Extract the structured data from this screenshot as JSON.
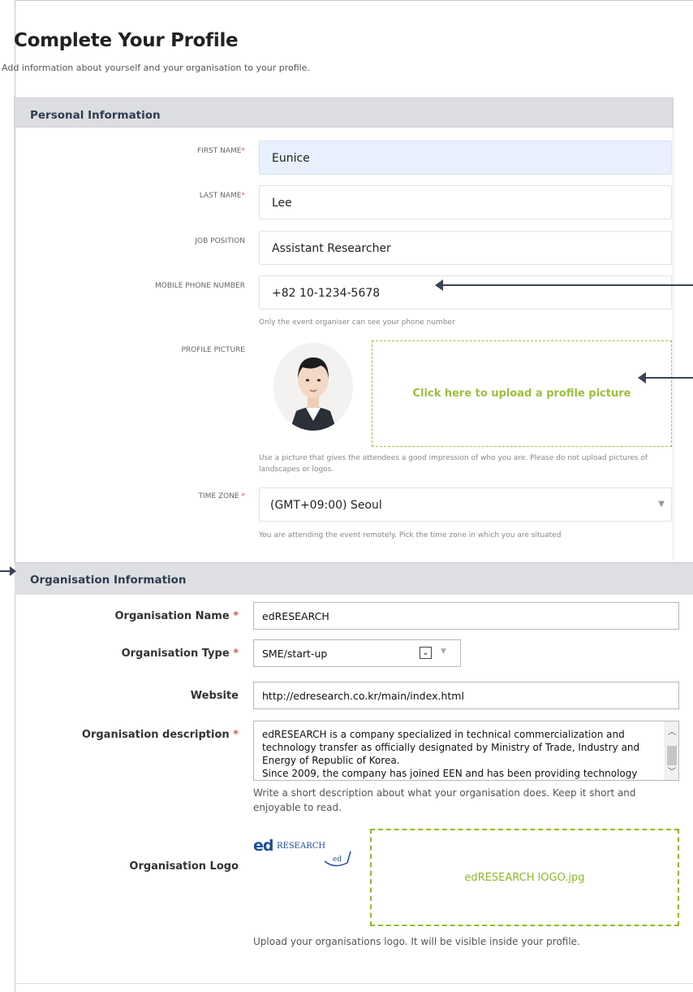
{
  "header": {
    "title": "Complete Your Profile",
    "subtitle": "Add information about yourself and your organisation to your profile."
  },
  "personal": {
    "section_title": "Personal Information",
    "first_name": {
      "label": "FIRST NAME",
      "required_mark": "*",
      "value": "Eunice"
    },
    "last_name": {
      "label": "LAST NAME",
      "required_mark": "*",
      "value": "Lee"
    },
    "job_position": {
      "label": "JOB POSITION",
      "value": "Assistant Researcher"
    },
    "mobile": {
      "label": "MOBILE PHONE NUMBER",
      "value": "+82 10-1234-5678",
      "help": "Only the event organiser can see your phone number"
    },
    "profile_picture": {
      "label": "PROFILE PICTURE",
      "upload_text": "Click here to upload a profile picture",
      "help": "Use a picture that gives the attendees a good impression of who you are. Please do not upload pictures of landscapes or logos."
    },
    "time_zone": {
      "label": "TIME ZONE",
      "required_mark": "*",
      "value": "(GMT+09:00) Seoul",
      "help": "You are attending the event remotely. Pick the time zone in which you are situated"
    }
  },
  "organisation": {
    "section_title": "Organisation Information",
    "name": {
      "label": "Organisation Name",
      "required_mark": "*",
      "value": "edRESEARCH"
    },
    "type": {
      "label": "Organisation Type",
      "required_mark": "*",
      "value": "SME/start-up"
    },
    "website": {
      "label": "Website",
      "value": "http://edresearch.co.kr/main/index.html"
    },
    "description": {
      "label": "Organisation description",
      "required_mark": "*",
      "value": "edRESEARCH is a company specialized in technical commercialization and technology transfer as officially designated by Ministry of Trade, Industry and Energy of Republic of Korea.\nSince 2009, the company has joined EEN and has been providing technology transfer platforms and networks to competent SMEs.",
      "help": "Write a short description about what your organisation does. Keep it short and enjoyable to read."
    },
    "logo": {
      "label": "Organisation Logo",
      "logo_text_ed": "ed",
      "logo_text_research": "RESEARCH",
      "file_name": "edRESEARCH lOGO.jpg",
      "help": "Upload your organisations logo. It will be visible inside your profile."
    }
  },
  "colors": {
    "accent_green": "#9cbf3b",
    "required_red": "#e05555",
    "header_gray": "#dcdde0",
    "logo_blue": "#1d4e9b"
  }
}
